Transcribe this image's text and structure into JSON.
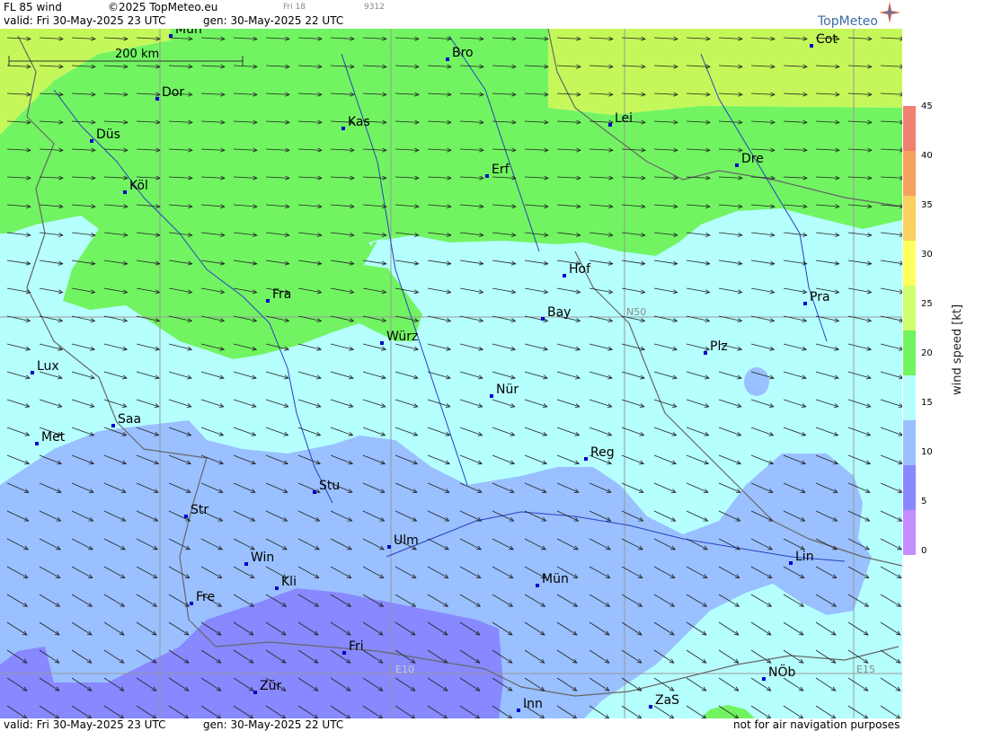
{
  "header": {
    "product": "FL 85 wind",
    "copyright": "©2025 TopMeteo.eu",
    "valid": "valid:  Fri  30-May-2025  23 UTC",
    "gen": "gen: 30-May-2025 22 UTC",
    "small_day": "Fri 18",
    "small_code": "9312",
    "logo": "TopMeteo"
  },
  "footer": {
    "valid": "valid:  Fri  30-May-2025  23 UTC",
    "gen": "gen: 30-May-2025 22 UTC",
    "disclaimer": "not for air navigation purposes"
  },
  "scale_bar": "200 km",
  "grid_labels": {
    "n50": "N50",
    "e10": "E10",
    "e15": "E15"
  },
  "cities": [
    {
      "name": "Mün"
    },
    {
      "name": "Bro"
    },
    {
      "name": "Cot"
    },
    {
      "name": "Dor"
    },
    {
      "name": "Kas"
    },
    {
      "name": "Lei"
    },
    {
      "name": "Düs"
    },
    {
      "name": "Erf"
    },
    {
      "name": "Dre"
    },
    {
      "name": "Köl"
    },
    {
      "name": "Hof"
    },
    {
      "name": "Fra"
    },
    {
      "name": "Pra"
    },
    {
      "name": "Bay"
    },
    {
      "name": "Würz"
    },
    {
      "name": "Plz"
    },
    {
      "name": "Lux"
    },
    {
      "name": "Nür"
    },
    {
      "name": "Saa"
    },
    {
      "name": "Met"
    },
    {
      "name": "Reg"
    },
    {
      "name": "Stu"
    },
    {
      "name": "Str"
    },
    {
      "name": "Ulm"
    },
    {
      "name": "Win"
    },
    {
      "name": "Lin"
    },
    {
      "name": "Kli"
    },
    {
      "name": "Mün"
    },
    {
      "name": "Fre"
    },
    {
      "name": "Fri"
    },
    {
      "name": "NÖb"
    },
    {
      "name": "Zür"
    },
    {
      "name": "ZaS"
    },
    {
      "name": "Inn"
    }
  ],
  "legend": {
    "title": "wind speed [kt]",
    "ticks": [
      "45",
      "40",
      "35",
      "30",
      "25",
      "20",
      "15",
      "10",
      "5",
      "0"
    ],
    "colors": [
      "#f08070",
      "#f6a25e",
      "#fbd060",
      "#ffff60",
      "#cfff70",
      "#72f462",
      "#b6ffff",
      "#9ac0ff",
      "#8888ff",
      "#c38cff"
    ]
  },
  "colors": {
    "green_dark": "#72f462",
    "green_light": "#c4f85a",
    "cyan": "#b6ffff",
    "blue_light": "#9ac0ff",
    "blue": "#8888ff"
  }
}
